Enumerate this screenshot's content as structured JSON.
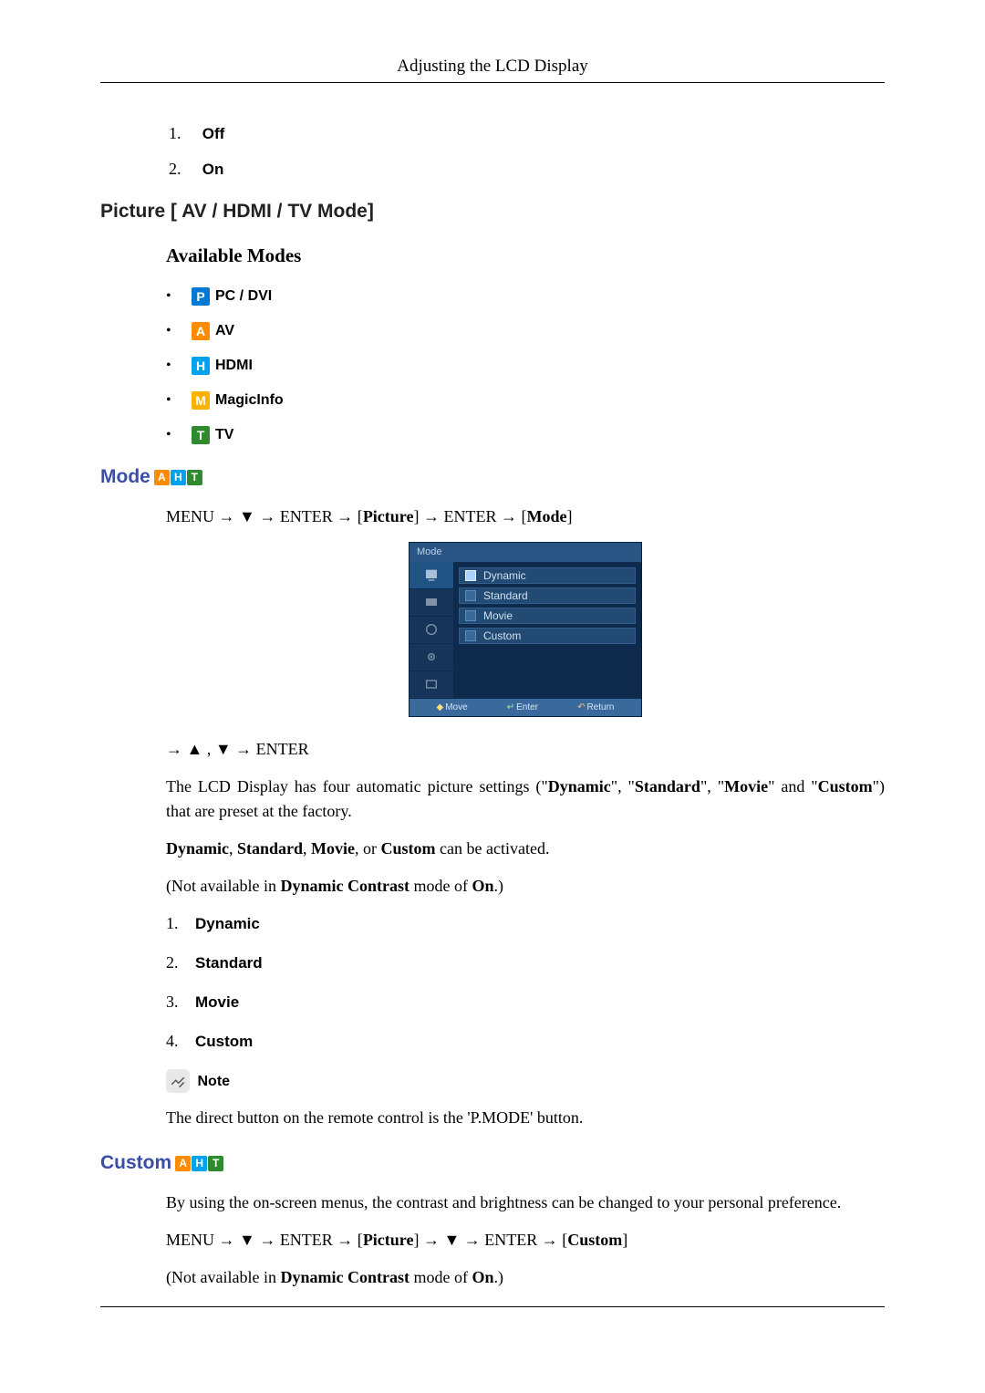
{
  "header": {
    "title": "Adjusting the LCD Display"
  },
  "offon": {
    "item1_num": "1.",
    "item1_label": "Off",
    "item2_num": "2.",
    "item2_label": "On"
  },
  "section_picture": {
    "title": "Picture [ AV / HDMI / TV Mode]"
  },
  "available_modes": {
    "heading": "Available Modes",
    "items": [
      {
        "badge": "P",
        "label": "PC / DVI"
      },
      {
        "badge": "A",
        "label": "AV"
      },
      {
        "badge": "H",
        "label": "HDMI"
      },
      {
        "badge": "M",
        "label": "MagicInfo"
      },
      {
        "badge": "T",
        "label": "TV"
      }
    ]
  },
  "mode": {
    "heading": "Mode",
    "menupath_pre": "MENU → ▼ → ENTER → [",
    "menupath_bold1": "Picture",
    "menupath_mid": "] → ENTER → [",
    "menupath_bold2": "Mode",
    "menupath_end": "]",
    "nav": "→ ▲ , ▼ → ENTER",
    "para1_pre": "The LCD Display has four automatic picture settings (\"",
    "para1_b1": "Dynamic",
    "para1_m1": "\", \"",
    "para1_b2": "Standard",
    "para1_m2": "\", \"",
    "para1_b3": "Movie",
    "para1_m3": "\" and \"",
    "para1_b4": "Custom",
    "para1_post": "\") that are preset at the factory.",
    "para2_b": "Dynamic",
    "para2_m1": ", ",
    "para2_b2": "Standard",
    "para2_m2": ", ",
    "para2_b3": "Movie",
    "para2_m3": ", or ",
    "para2_b4": "Custom",
    "para2_post": " can be activated.",
    "para3_pre": "(Not available in ",
    "para3_b1": "Dynamic Contrast",
    "para3_mid": " mode of ",
    "para3_b2": "On",
    "para3_post": ".)",
    "list": [
      {
        "num": "1.",
        "val": "Dynamic"
      },
      {
        "num": "2.",
        "val": "Standard"
      },
      {
        "num": "3.",
        "val": "Movie"
      },
      {
        "num": "4.",
        "val": "Custom"
      }
    ],
    "note_label": "Note",
    "note_text": "The direct button on the remote control is the 'P.MODE' button."
  },
  "osd": {
    "title": "Mode",
    "items": [
      "Dynamic",
      "Standard",
      "Movie",
      "Custom"
    ],
    "footer": {
      "move": "Move",
      "enter": "Enter",
      "return": "Return"
    }
  },
  "custom": {
    "heading": "Custom",
    "para1": "By using the on-screen menus, the contrast and brightness can be changed to your personal preference.",
    "menupath_pre": "MENU → ▼ → ENTER → [",
    "menupath_bold1": "Picture",
    "menupath_mid": "] → ▼ → ENTER → [",
    "menupath_bold2": "Custom",
    "menupath_end": "]",
    "para3_pre": "(Not available in ",
    "para3_b1": "Dynamic Contrast",
    "para3_mid": " mode of ",
    "para3_b2": "On",
    "para3_post": ".)"
  }
}
